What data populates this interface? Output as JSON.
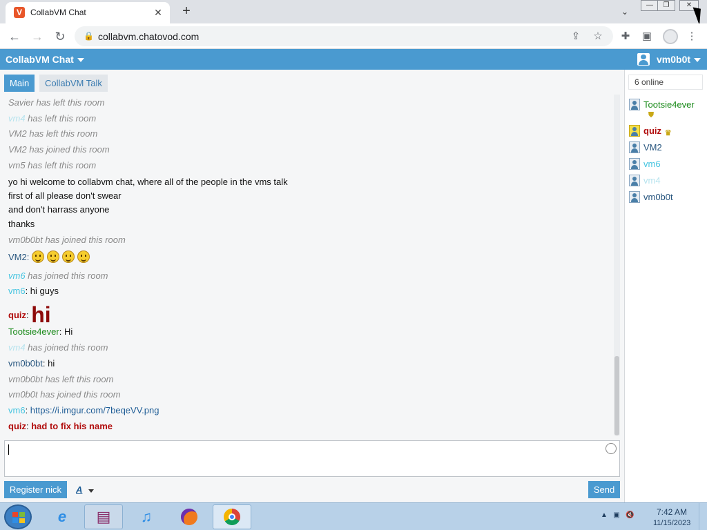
{
  "browser": {
    "tab_title": "CollabVM Chat",
    "tab_favicon": "V",
    "url": "collabvm.chatovod.com",
    "icons": [
      "back-icon",
      "forward-icon",
      "reload-icon",
      "lock-icon",
      "share-icon",
      "star-icon",
      "extensions-icon",
      "sidepanel-icon",
      "profile-icon",
      "menu-icon"
    ]
  },
  "app": {
    "title": "CollabVM Chat",
    "current_user": "vm0b0t",
    "accent_color": "#4a9ad0"
  },
  "rooms": [
    {
      "label": "Main",
      "active": true
    },
    {
      "label": "CollabVM Talk",
      "active": false
    }
  ],
  "messages": [
    {
      "type": "system",
      "nick": "Savier",
      "text": "Savier has left this room"
    },
    {
      "type": "system",
      "nick": "vm4",
      "text": " has left this room"
    },
    {
      "type": "system",
      "nick": "VM2",
      "text": "VM2 has left this room"
    },
    {
      "type": "system",
      "nick": "VM2",
      "text": "VM2 has joined this room"
    },
    {
      "type": "system",
      "nick": "vm5",
      "text": "vm5 has left this room"
    },
    {
      "type": "plain",
      "text": "yo hi welcome to collabvm chat, where all of the people in the vms talk"
    },
    {
      "type": "plain",
      "text": "first of all please don't swear"
    },
    {
      "type": "plain",
      "text": "and don't harrass anyone"
    },
    {
      "type": "plain",
      "text": "thanks"
    },
    {
      "type": "system",
      "nick": "vm0b0bt",
      "text": "vm0b0bt has joined this room"
    },
    {
      "type": "chat",
      "nick": "VM2",
      "text": "",
      "emojis": 4
    },
    {
      "type": "system",
      "nick": "vm6",
      "text": " has joined this room"
    },
    {
      "type": "chat",
      "nick": "vm6",
      "text": "hi guys"
    },
    {
      "type": "chat",
      "nick": "quiz",
      "text": "hi"
    },
    {
      "type": "chat",
      "nick": "Tootsie4ever",
      "text": "Hi"
    },
    {
      "type": "system",
      "nick": "vm4",
      "text": " has joined this room"
    },
    {
      "type": "chat",
      "nick": "vm0b0bt",
      "text": "hi"
    },
    {
      "type": "system",
      "nick": "vm0b0bt",
      "text": "vm0b0bt has left this room"
    },
    {
      "type": "system",
      "nick": "vm0b0t",
      "text": "vm0b0t has joined this room"
    },
    {
      "type": "chat",
      "nick": "vm6",
      "text": "https://i.imgur.com/7beqeVV.png"
    },
    {
      "type": "chat",
      "nick": "quiz",
      "text": "had to fix his name"
    }
  ],
  "composer": {
    "value": "",
    "register_label": "Register nick",
    "format_label": "A",
    "send_label": "Send"
  },
  "userlist": {
    "online_label": "6 online",
    "users": [
      {
        "name": "Tootsie4ever",
        "color": "#1a8a1a",
        "badge": "shield-icon"
      },
      {
        "name": "quiz",
        "color": "#b10d0d",
        "badge": "crown-icon"
      },
      {
        "name": "VM2",
        "color": "#27557e",
        "badge": ""
      },
      {
        "name": "vm6",
        "color": "#44c4e0",
        "badge": ""
      },
      {
        "name": "vm4",
        "color": "#b6e3ee",
        "badge": ""
      },
      {
        "name": "vm0b0t",
        "color": "#27557e",
        "badge": ""
      }
    ]
  },
  "taskbar": {
    "time": "7:42 AM",
    "date": "11/15/2023",
    "apps": [
      "ie-icon",
      "winrar-icon",
      "itunes-icon",
      "firefox-icon",
      "chrome-icon"
    ]
  }
}
